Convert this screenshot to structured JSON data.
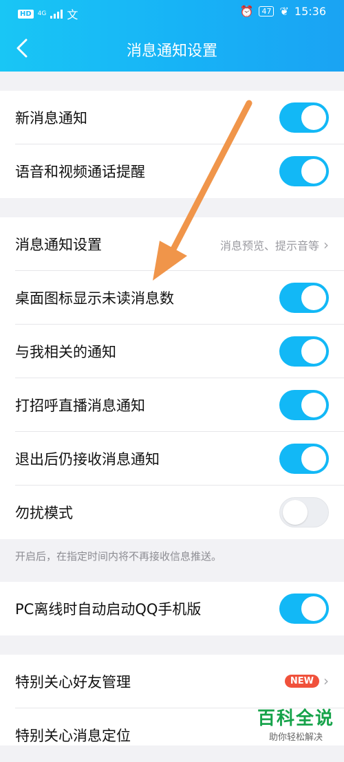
{
  "status_bar": {
    "hd": "HD",
    "net": "4G",
    "time": "15:36",
    "battery": "47"
  },
  "header": {
    "title": "消息通知设置"
  },
  "group1": [
    {
      "label": "新消息通知",
      "on": true
    },
    {
      "label": "语音和视频通话提醒",
      "on": true
    }
  ],
  "group2": {
    "settings_row": {
      "label": "消息通知设置",
      "value": "消息预览、提示音等"
    },
    "toggles": [
      {
        "label": "桌面图标显示未读消息数",
        "on": true
      },
      {
        "label": "与我相关的通知",
        "on": true
      },
      {
        "label": "打招呼直播消息通知",
        "on": true
      },
      {
        "label": "退出后仍接收消息通知",
        "on": true
      },
      {
        "label": "勿扰模式",
        "on": false
      }
    ],
    "hint": "开启后，在指定时间内将不再接收信息推送。"
  },
  "group3": [
    {
      "label": "PC离线时自动启动QQ手机版",
      "on": true
    }
  ],
  "group4": {
    "special_friends": {
      "label": "特别关心好友管理",
      "badge": "NEW"
    },
    "special_location": {
      "label": "特别关心消息定位"
    }
  },
  "watermark": {
    "title": "百科全说",
    "subtitle": "助你轻松解决"
  },
  "colors": {
    "accent": "#12b8f6",
    "badge": "#f0513b",
    "arrow": "#f0954a"
  }
}
